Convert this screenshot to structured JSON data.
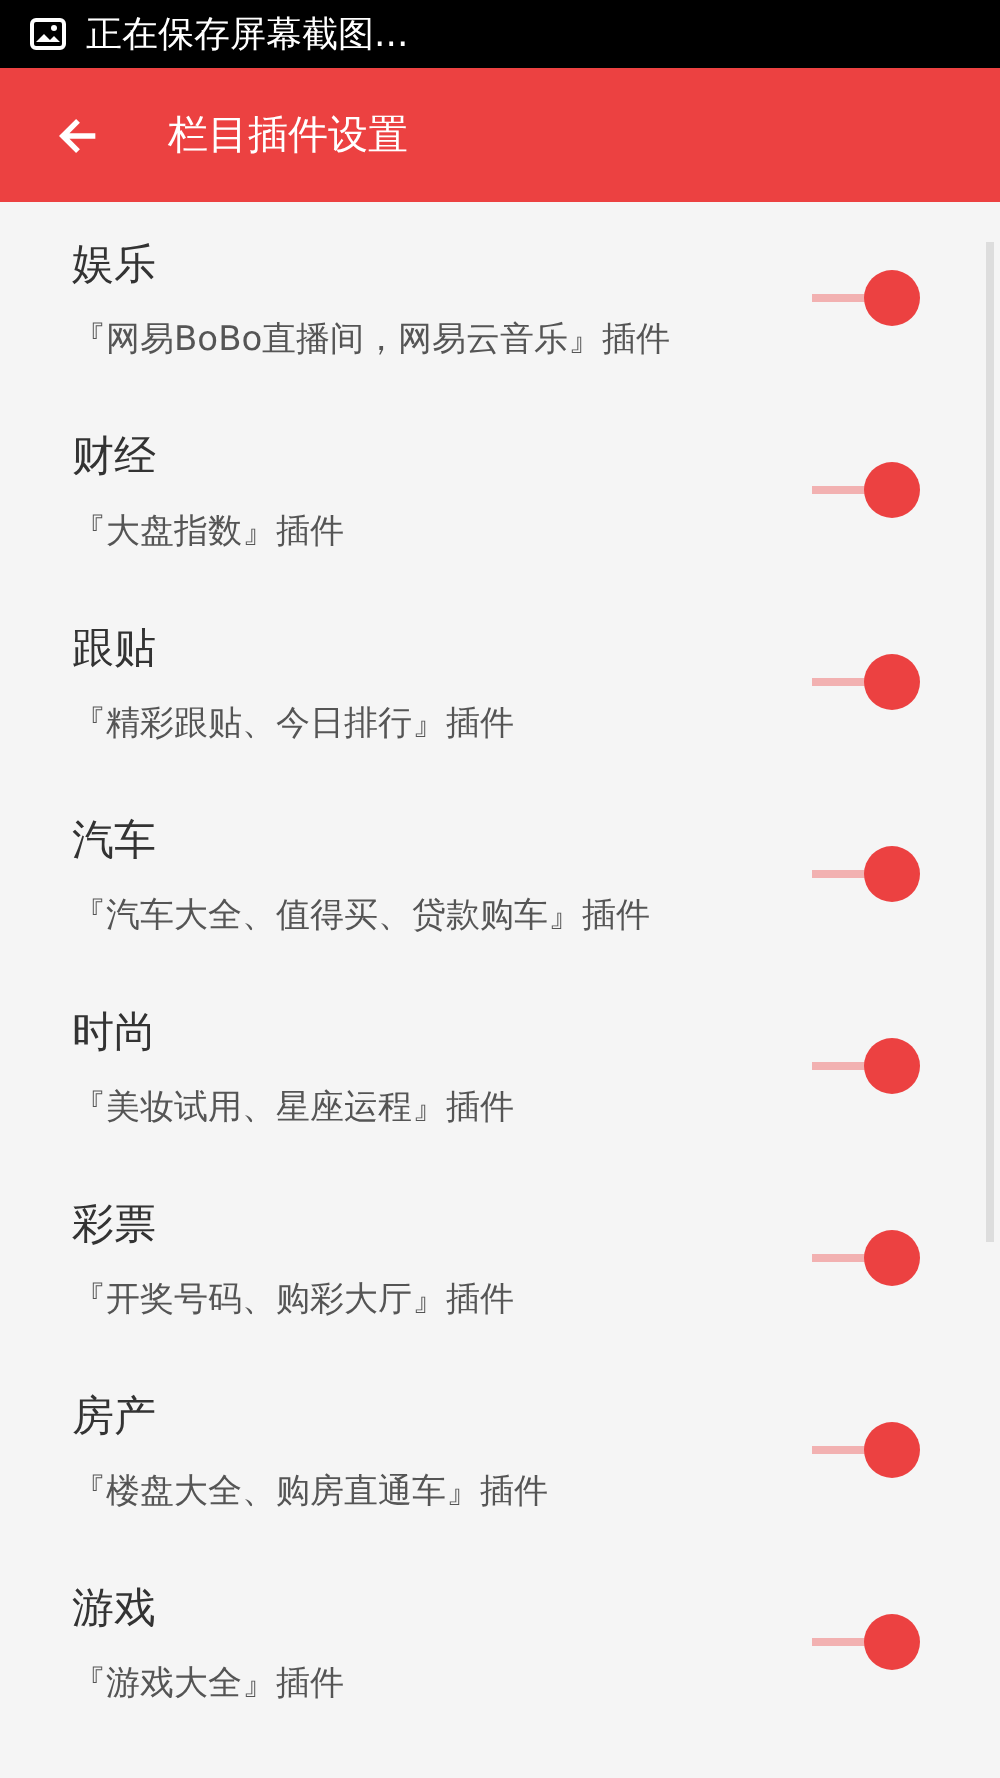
{
  "status_bar": {
    "text": "正在保存屏幕截图..."
  },
  "app_bar": {
    "title": "栏目插件设置"
  },
  "items": [
    {
      "title": "娱乐",
      "subtitle": "『网易BoBo直播间，网易云音乐』插件",
      "on": true
    },
    {
      "title": "财经",
      "subtitle": "『大盘指数』插件",
      "on": true
    },
    {
      "title": "跟贴",
      "subtitle": "『精彩跟贴、今日排行』插件",
      "on": true
    },
    {
      "title": "汽车",
      "subtitle": "『汽车大全、值得买、贷款购车』插件",
      "on": true
    },
    {
      "title": "时尚",
      "subtitle": "『美妆试用、星座运程』插件",
      "on": true
    },
    {
      "title": "彩票",
      "subtitle": "『开奖号码、购彩大厅』插件",
      "on": true
    },
    {
      "title": "房产",
      "subtitle": "『楼盘大全、购房直通车』插件",
      "on": true
    },
    {
      "title": "游戏",
      "subtitle": "『游戏大全』插件",
      "on": true
    }
  ]
}
